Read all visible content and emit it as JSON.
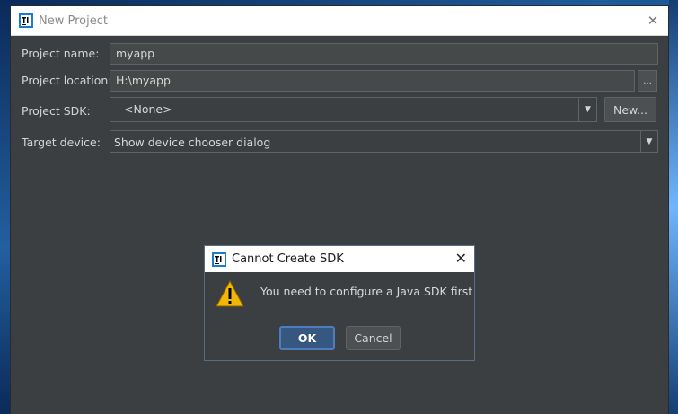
{
  "window": {
    "title": "New Project",
    "close_glyph": "✕"
  },
  "form": {
    "project_name": {
      "label": "Project name:",
      "value": "myapp"
    },
    "project_location": {
      "label": "Project location:",
      "value": "H:\\myapp",
      "browse_label": "..."
    },
    "project_sdk": {
      "label": "Project SDK:",
      "value": "<None>",
      "new_button_label": "New..."
    },
    "target_device": {
      "label": "Target device:",
      "value": "Show device chooser dialog"
    }
  },
  "dialog": {
    "title": "Cannot Create SDK",
    "message": "You need to configure a Java SDK first",
    "ok_label": "OK",
    "cancel_label": "Cancel",
    "close_glyph": "✕",
    "icon": "warning-icon"
  },
  "colors": {
    "accent": "#365880",
    "panel": "#3c3f41",
    "warning": "#f2b705"
  }
}
